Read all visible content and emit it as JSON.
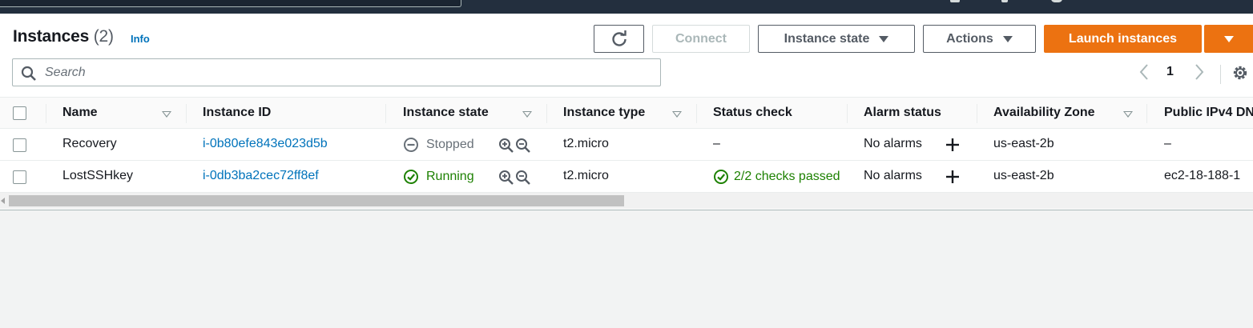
{
  "header": {
    "title": "Instances",
    "count": "(2)",
    "info_link": "Info"
  },
  "toolbar": {
    "refresh_icon": "refresh-icon",
    "connect_label": "Connect",
    "instance_state_label": "Instance state",
    "actions_label": "Actions",
    "launch_label": "Launch instances"
  },
  "search": {
    "placeholder": "Search"
  },
  "pagination": {
    "current_page": "1"
  },
  "table": {
    "columns": [
      "Name",
      "Instance ID",
      "Instance state",
      "Instance type",
      "Status check",
      "Alarm status",
      "Availability Zone",
      "Public IPv4 DN"
    ],
    "rows": [
      {
        "name": "Recovery",
        "instance_id": "i-0b80efe843e023d5b",
        "state": "Stopped",
        "type": "t2.micro",
        "status_check": "–",
        "alarm_status": "No alarms",
        "az": "us-east-2b",
        "public_ipv4": "–"
      },
      {
        "name": "LostSSHkey",
        "instance_id": "i-0db3ba2cec72ff8ef",
        "state": "Running",
        "type": "t2.micro",
        "status_check": "2/2 checks passed",
        "alarm_status": "No alarms",
        "az": "us-east-2b",
        "public_ipv4": "ec2-18-188-1"
      }
    ]
  },
  "colors": {
    "accent": "#ec7211",
    "link": "#0073bb",
    "success": "#1d8102",
    "topbar": "#232f3e"
  }
}
